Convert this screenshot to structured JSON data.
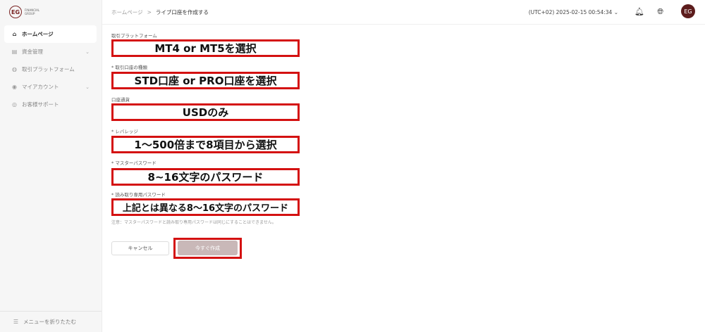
{
  "logo": {
    "mark": "EG",
    "text": "FINANCIAL GROUP"
  },
  "sidebar": {
    "items": [
      {
        "label": "ホームページ",
        "icon": "home-icon"
      },
      {
        "label": "資金管理",
        "icon": "wallet-icon"
      },
      {
        "label": "取引プラットフォーム",
        "icon": "platform-icon"
      },
      {
        "label": "マイアカウント",
        "icon": "user-icon"
      },
      {
        "label": "お客様サポート",
        "icon": "support-icon"
      }
    ],
    "collapse_label": "メニューを折りたたむ"
  },
  "header": {
    "breadcrumb_home": "ホームページ",
    "breadcrumb_sep": ">",
    "breadcrumb_current": "ライブ口座を作成する",
    "timezone": "(UTC+02)  2025-02-15 00:54:34"
  },
  "form": {
    "fields": [
      {
        "label": "取引プラットフォーム",
        "value": "MT4 or MT5を選択"
      },
      {
        "label": "* 取引口座の種類",
        "value": "STD口座 or PRO口座を選択"
      },
      {
        "label": "口座通貨",
        "value": "USDのみ"
      },
      {
        "label": "* レバレッジ",
        "value": "1〜500倍まで8項目から選択"
      },
      {
        "label": "* マスターパスワード",
        "value": "8~16文字のパスワード"
      },
      {
        "label": "* 読み取り専用パスワード",
        "value": "上記とは異なる8〜16文字のパスワード"
      }
    ],
    "note": "注意：マスターパスワードと読み取り専用パスワードは同じにすることはできません。",
    "cancel_label": "キャンセル",
    "create_label": "今すぐ作成"
  },
  "colors": {
    "highlight": "#d41111",
    "brand": "#5c1c1c"
  }
}
